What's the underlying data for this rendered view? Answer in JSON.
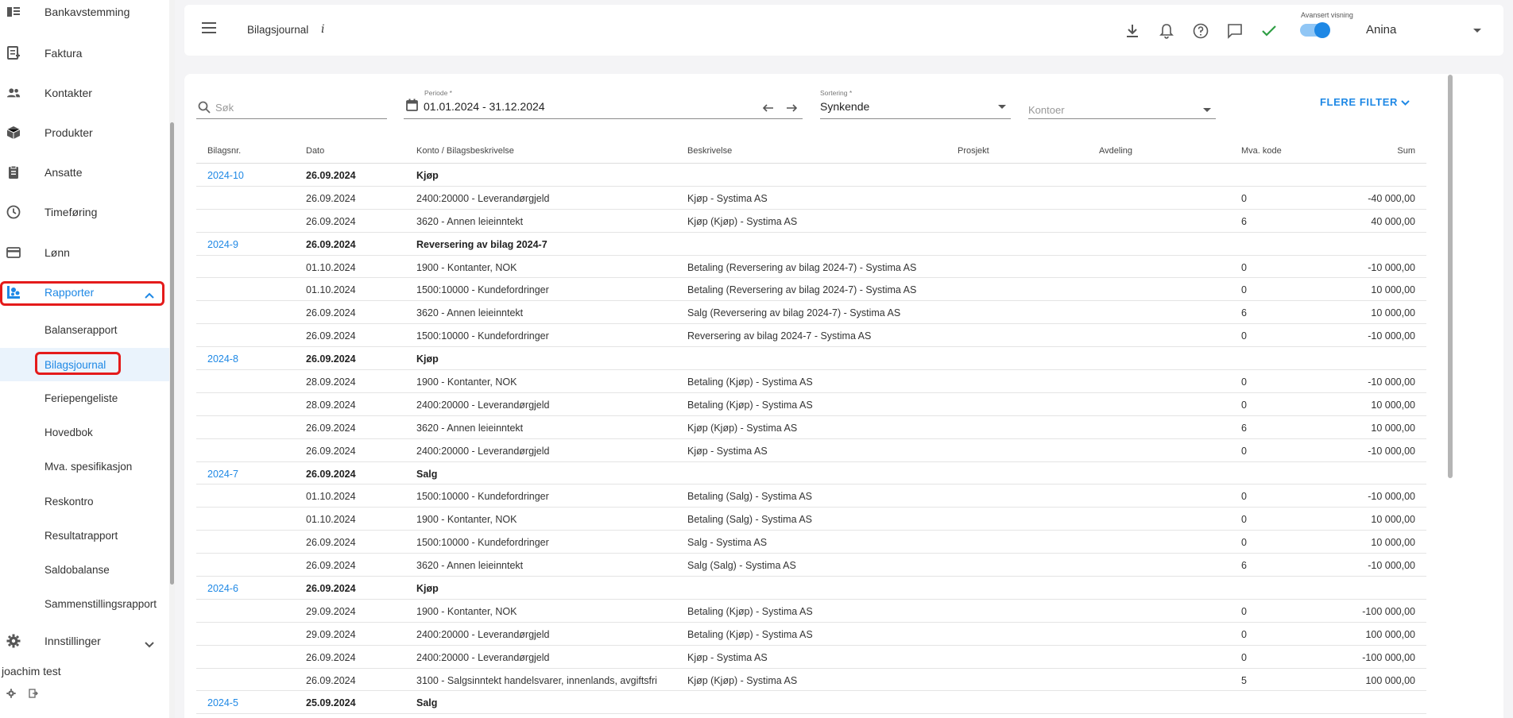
{
  "sidebar": {
    "items": [
      {
        "label": "Bankavstemming",
        "icon": "bank-reconcile-icon"
      },
      {
        "label": "Faktura",
        "icon": "invoice-icon"
      },
      {
        "label": "Kontakter",
        "icon": "contacts-icon"
      },
      {
        "label": "Produkter",
        "icon": "box-icon"
      },
      {
        "label": "Ansatte",
        "icon": "clipboard-icon"
      },
      {
        "label": "Timeføring",
        "icon": "clock-icon"
      },
      {
        "label": "Lønn",
        "icon": "card-icon"
      },
      {
        "label": "Rapporter",
        "icon": "reports-icon"
      }
    ],
    "report_items": [
      "Balanserapport",
      "Bilagsjournal",
      "Feriepengeliste",
      "Hovedbok",
      "Mva. spesifikasjon",
      "Reskontro",
      "Resultatrapport",
      "Saldobalanse",
      "Sammenstillingsrapport"
    ],
    "settings_label": "Innstillinger",
    "user_name": "joachim test"
  },
  "header": {
    "title": "Bilagsjournal",
    "info": "i",
    "advanced_label": "Avansert visning",
    "user": "Anina"
  },
  "filters": {
    "search_placeholder": "Søk",
    "period_label": "Periode *",
    "period_value": "01.01.2024 - 31.12.2024",
    "sort_label": "Sortering *",
    "sort_value": "Synkende",
    "kontoer_placeholder": "Kontoer",
    "more_filters": "FLERE FILTER"
  },
  "table": {
    "headers": [
      "Bilagsnr.",
      "Dato",
      "Konto / Bilagsbeskrivelse",
      "Beskrivelse",
      "Prosjekt",
      "Avdeling",
      "Mva. kode",
      "Sum"
    ],
    "rows": [
      {
        "type": "group",
        "bilag": "2024-10",
        "dato": "26.09.2024",
        "konto": "Kjøp"
      },
      {
        "type": "line",
        "dato": "26.09.2024",
        "konto": "2400:20000 - Leverandørgjeld",
        "beskr": "Kjøp - Systima AS",
        "mva": "0",
        "sum": "-40 000,00"
      },
      {
        "type": "line",
        "dato": "26.09.2024",
        "konto": "3620 - Annen leieinntekt",
        "beskr": "Kjøp (Kjøp) - Systima AS",
        "mva": "6",
        "sum": "40 000,00"
      },
      {
        "type": "group",
        "bilag": "2024-9",
        "dato": "26.09.2024",
        "konto": "Reversering av bilag 2024-7"
      },
      {
        "type": "line",
        "dato": "01.10.2024",
        "konto": "1900 - Kontanter, NOK",
        "beskr": "Betaling (Reversering av bilag 2024-7) - Systima AS",
        "mva": "0",
        "sum": "-10 000,00"
      },
      {
        "type": "line",
        "dato": "01.10.2024",
        "konto": "1500:10000 - Kundefordringer",
        "beskr": "Betaling (Reversering av bilag 2024-7) - Systima AS",
        "mva": "0",
        "sum": "10 000,00"
      },
      {
        "type": "line",
        "dato": "26.09.2024",
        "konto": "3620 - Annen leieinntekt",
        "beskr": "Salg (Reversering av bilag 2024-7) - Systima AS",
        "mva": "6",
        "sum": "10 000,00"
      },
      {
        "type": "line",
        "dato": "26.09.2024",
        "konto": "1500:10000 - Kundefordringer",
        "beskr": "Reversering av bilag 2024-7 - Systima AS",
        "mva": "0",
        "sum": "-10 000,00"
      },
      {
        "type": "group",
        "bilag": "2024-8",
        "dato": "26.09.2024",
        "konto": "Kjøp"
      },
      {
        "type": "line",
        "dato": "28.09.2024",
        "konto": "1900 - Kontanter, NOK",
        "beskr": "Betaling (Kjøp) - Systima AS",
        "mva": "0",
        "sum": "-10 000,00"
      },
      {
        "type": "line",
        "dato": "28.09.2024",
        "konto": "2400:20000 - Leverandørgjeld",
        "beskr": "Betaling (Kjøp) - Systima AS",
        "mva": "0",
        "sum": "10 000,00"
      },
      {
        "type": "line",
        "dato": "26.09.2024",
        "konto": "3620 - Annen leieinntekt",
        "beskr": "Kjøp (Kjøp) - Systima AS",
        "mva": "6",
        "sum": "10 000,00"
      },
      {
        "type": "line",
        "dato": "26.09.2024",
        "konto": "2400:20000 - Leverandørgjeld",
        "beskr": "Kjøp - Systima AS",
        "mva": "0",
        "sum": "-10 000,00"
      },
      {
        "type": "group",
        "bilag": "2024-7",
        "dato": "26.09.2024",
        "konto": "Salg"
      },
      {
        "type": "line",
        "dato": "01.10.2024",
        "konto": "1500:10000 - Kundefordringer",
        "beskr": "Betaling (Salg) - Systima AS",
        "mva": "0",
        "sum": "-10 000,00"
      },
      {
        "type": "line",
        "dato": "01.10.2024",
        "konto": "1900 - Kontanter, NOK",
        "beskr": "Betaling (Salg) - Systima AS",
        "mva": "0",
        "sum": "10 000,00"
      },
      {
        "type": "line",
        "dato": "26.09.2024",
        "konto": "1500:10000 - Kundefordringer",
        "beskr": "Salg - Systima AS",
        "mva": "0",
        "sum": "10 000,00"
      },
      {
        "type": "line",
        "dato": "26.09.2024",
        "konto": "3620 - Annen leieinntekt",
        "beskr": "Salg (Salg) - Systima AS",
        "mva": "6",
        "sum": "-10 000,00"
      },
      {
        "type": "group",
        "bilag": "2024-6",
        "dato": "26.09.2024",
        "konto": "Kjøp"
      },
      {
        "type": "line",
        "dato": "29.09.2024",
        "konto": "1900 - Kontanter, NOK",
        "beskr": "Betaling (Kjøp) - Systima AS",
        "mva": "0",
        "sum": "-100 000,00"
      },
      {
        "type": "line",
        "dato": "29.09.2024",
        "konto": "2400:20000 - Leverandørgjeld",
        "beskr": "Betaling (Kjøp) - Systima AS",
        "mva": "0",
        "sum": "100 000,00"
      },
      {
        "type": "line",
        "dato": "26.09.2024",
        "konto": "2400:20000 - Leverandørgjeld",
        "beskr": "Kjøp - Systima AS",
        "mva": "0",
        "sum": "-100 000,00"
      },
      {
        "type": "line",
        "dato": "26.09.2024",
        "konto": "3100 - Salgsinntekt handelsvarer, innenlands, avgiftsfri",
        "beskr": "Kjøp (Kjøp) - Systima AS",
        "mva": "5",
        "sum": "100 000,00"
      },
      {
        "type": "group",
        "bilag": "2024-5",
        "dato": "25.09.2024",
        "konto": "Salg"
      }
    ]
  },
  "colors": {
    "accent": "#1e88e5",
    "highlight_box": "#e41b1b",
    "check": "#2e9e44"
  }
}
